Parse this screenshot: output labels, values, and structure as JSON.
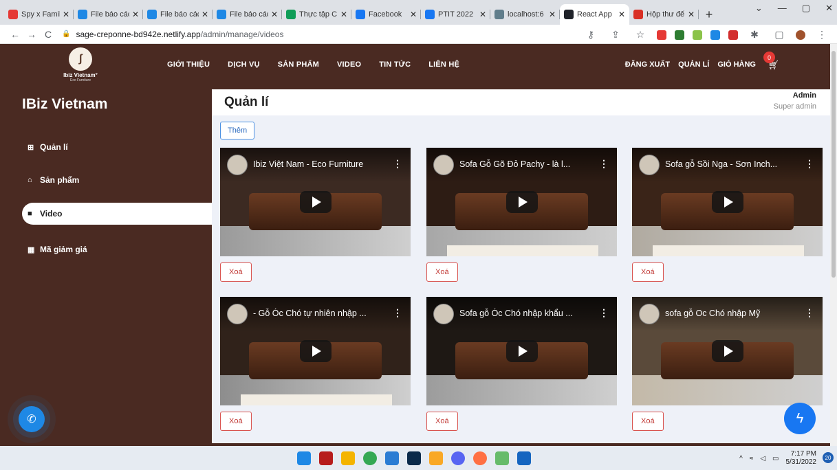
{
  "browser": {
    "tabs": [
      {
        "title": "Spy x Famil",
        "color": "#e53935"
      },
      {
        "title": "File báo các",
        "color": "#1e88e5"
      },
      {
        "title": "File báo các",
        "color": "#1e88e5"
      },
      {
        "title": "File báo các",
        "color": "#1e88e5"
      },
      {
        "title": "Thực tập C",
        "color": "#0f9d58"
      },
      {
        "title": "Facebook",
        "color": "#1877f2"
      },
      {
        "title": "PTIT 2022",
        "color": "#1877f2"
      },
      {
        "title": "localhost:6",
        "color": "#607d8b"
      },
      {
        "title": "React App",
        "color": "#20232a",
        "active": true
      },
      {
        "title": "Hộp thư đế",
        "color": "#d93025"
      }
    ],
    "url_host": "sage-creponne-bd942e.netlify.app",
    "url_path": "/admin/manage/videos"
  },
  "header": {
    "logo_brand": "Ibiz Vietnam°",
    "logo_tag": "Eco Furniture",
    "nav": [
      "GIỚI THIỆU",
      "DỊCH VỤ",
      "SẢN PHẨM",
      "VIDEO",
      "TIN TỨC",
      "LIÊN HỆ"
    ],
    "right_nav": [
      "ĐĂNG XUẤT",
      "QUẢN LÍ",
      "GIỎ HÀNG"
    ],
    "cart_count": "0"
  },
  "sidebar": {
    "title": "IBiz Vietnam",
    "items": [
      {
        "label": "Quản lí",
        "icon": "⊞"
      },
      {
        "label": "Sản phẩm",
        "icon": "⌂"
      },
      {
        "label": "Video",
        "icon": "■",
        "active": true
      },
      {
        "label": "Mã giảm giá",
        "icon": "▦"
      }
    ]
  },
  "main": {
    "title": "Quản lí",
    "user_name": "Admin",
    "user_role": "Super admin",
    "add_label": "Thêm",
    "delete_label": "Xoá",
    "videos": [
      {
        "title": "Ibiz Việt Nam - Eco Furniture"
      },
      {
        "title": "Sofa Gỗ Gõ Đỏ Pachy - là l..."
      },
      {
        "title": "Sofa gỗ Sồi Nga - Sơn Inch..."
      },
      {
        "title": "- Gỗ Óc Chó tự nhiên nhập ..."
      },
      {
        "title": "Sofa gỗ Óc Chó nhập khẩu ..."
      },
      {
        "title": "sofa gỗ Oc Chó nhập Mỹ"
      }
    ]
  },
  "taskbar": {
    "time": "7:17 PM",
    "date": "5/31/2022",
    "notification_count": "20"
  }
}
